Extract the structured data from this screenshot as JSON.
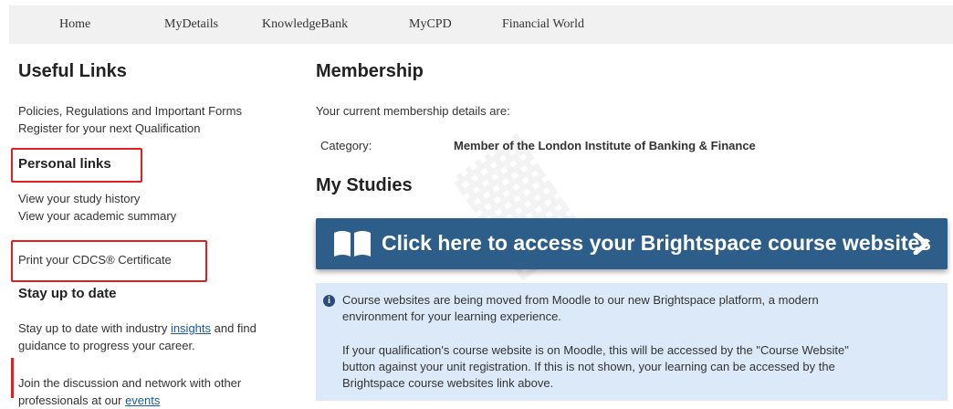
{
  "nav": {
    "items": [
      "Home",
      "MyDetails",
      "KnowledgeBank",
      "MyCPD",
      "Financial World"
    ]
  },
  "left": {
    "useful_links_heading": "Useful Links",
    "useful_links": [
      "Policies, Regulations and Important Forms",
      "Register for your next Qualification"
    ],
    "personal_links_heading": "Personal links",
    "personal_links": [
      "View your study history",
      "View your academic summary"
    ],
    "cdcs_link": "Print your CDCS® Certificate",
    "stay_heading": "Stay up to date",
    "stay_p1_before": "Stay up to date with industry ",
    "stay_p1_link": "insights",
    "stay_p1_after": " and find",
    "stay_p1_line2": "guidance to progress your career.",
    "stay_p2_line1": "Join the discussion and network with other",
    "stay_p2_before": "professionals at our ",
    "stay_p2_link": "events"
  },
  "membership": {
    "heading": "Membership",
    "intro": "Your current membership details are:",
    "category_label": "Category:",
    "category_value": "Member of the London Institute of Banking & Finance"
  },
  "studies": {
    "heading": "My Studies",
    "banner_text": "Click here to access your Brightspace course websites",
    "info_line1": "Course websites are being moved from Moodle to our new Brightspace platform, a modern",
    "info_line2": "environment for your learning experience.",
    "info_line3": "If your qualification's course website is on Moodle, this will be accessed by the \"Course Website\"",
    "info_line4": "button against your unit registration. If this is not shown, your learning can be accessed by the",
    "info_line5": "Brightspace course websites link above."
  },
  "colors": {
    "banner": "#2d5e8a",
    "info_background": "#dbe9f8",
    "highlight_box": "#e02020",
    "link": "#1a5aa8"
  }
}
